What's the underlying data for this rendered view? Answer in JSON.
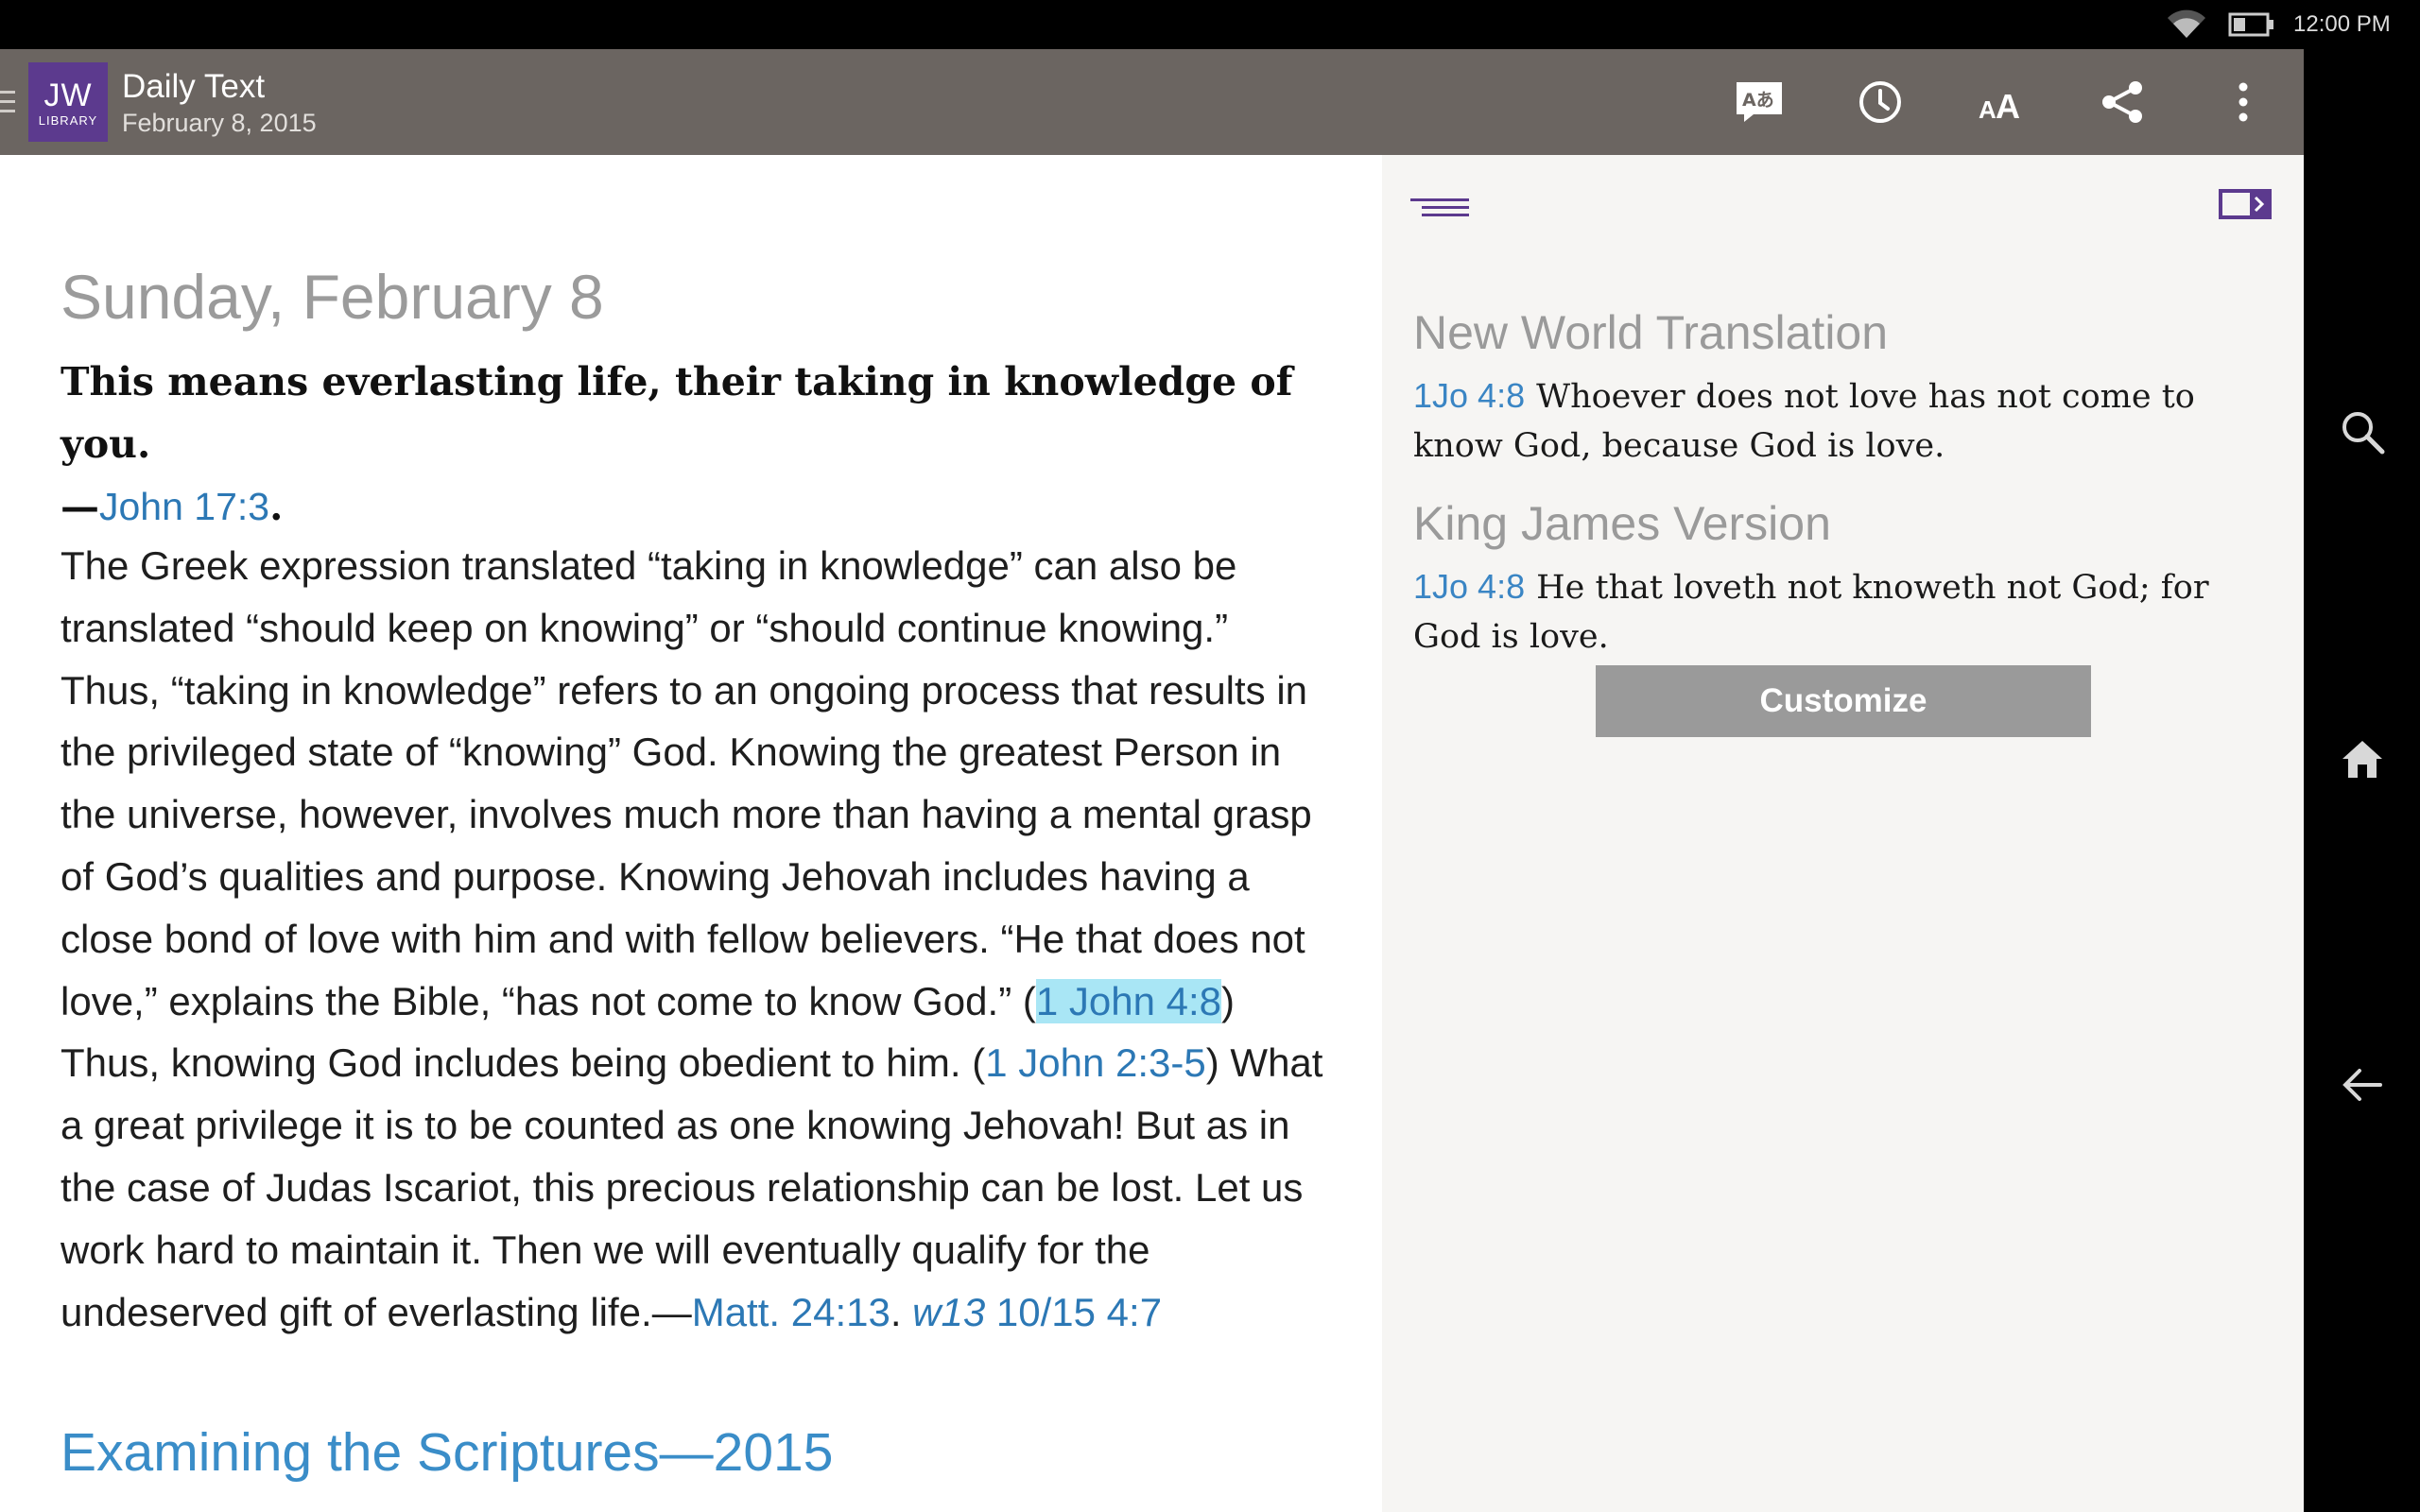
{
  "status_bar": {
    "time": "12:00 PM",
    "icons": [
      "wifi-icon",
      "battery-icon"
    ]
  },
  "toolbar": {
    "logo_main": "JW",
    "logo_sub": "LIBRARY",
    "title": "Daily Text",
    "subtitle": "February 8, 2015",
    "icons": [
      "language-icon",
      "history-icon",
      "text-size-icon",
      "share-icon",
      "more-icon"
    ],
    "text_size_label": "AA"
  },
  "main": {
    "day_heading": "Sunday, February 8",
    "theme_text": "This means everlasting life, their taking in knowledge of you.",
    "theme_dash": "—",
    "theme_ref": "John 17:3",
    "theme_end": ".",
    "body": {
      "p1": "The Greek expression translated “taking in knowledge” can also be translated “should keep on knowing” or “should continue knowing.” Thus, “taking in knowledge” refers to an ongoing process that results in the privileged state of “knowing” God. Knowing the greatest Person in the universe, however, involves much more than having a mental grasp of God’s qualities and purpose. Knowing Jehovah includes having a close bond of love with him and with fellow believers. “He that does not love,” explains the Bible, “has not come to know God.” (",
      "ref1": "1 John 4:8",
      "p2": ") Thus, knowing God includes being obedient to him. (",
      "ref2": "1 John 2:3-5",
      "p3": ") What a great privilege it is to be counted as one knowing Jehovah! But as in the case of Judas Iscariot, this precious relationship can be lost. Let us work hard to maintain it. Then we will eventually qualify for the undeserved gift of everlasting life.—",
      "ref3": "Matt. 24:13",
      "sep": ". ",
      "ref4_italic": "w13",
      "ref4_rest": " 10/15 4:7"
    },
    "book_title": "Examining the Scriptures—2015"
  },
  "side": {
    "versions": [
      {
        "name": "New World Translation",
        "ref": "1Jo 4:8",
        "text": "Whoever does not love has not come to know God, because God is love."
      },
      {
        "name": "King James Version",
        "ref": "1Jo 4:8",
        "text": "He that loveth not knoweth not God; for God is love."
      }
    ],
    "customize_label": "Customize"
  },
  "nav": {
    "icons": [
      "search-icon",
      "home-icon",
      "back-icon"
    ]
  },
  "colors": {
    "toolbar_bg": "#6b6561",
    "logo_bg": "#5c3a8e",
    "link": "#2c78b5",
    "highlight": "#a9e6f5",
    "side_bg": "#f6f5f3",
    "button_bg": "#9a9a9a"
  }
}
